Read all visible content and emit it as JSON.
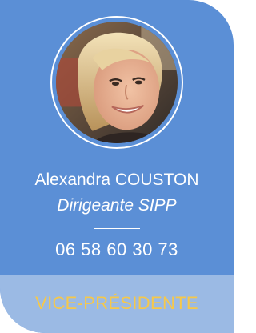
{
  "person": {
    "name": "Alexandra COUSTON",
    "position": "Dirigeante SIPP",
    "phone": "06 58 60 30 73",
    "title": "VICE-PRÉSIDENTE"
  },
  "colors": {
    "card_blue": "#5b8fd6",
    "band_blue": "#9bbae4",
    "title_yellow": "#f6c84a",
    "text_white": "#ffffff"
  }
}
